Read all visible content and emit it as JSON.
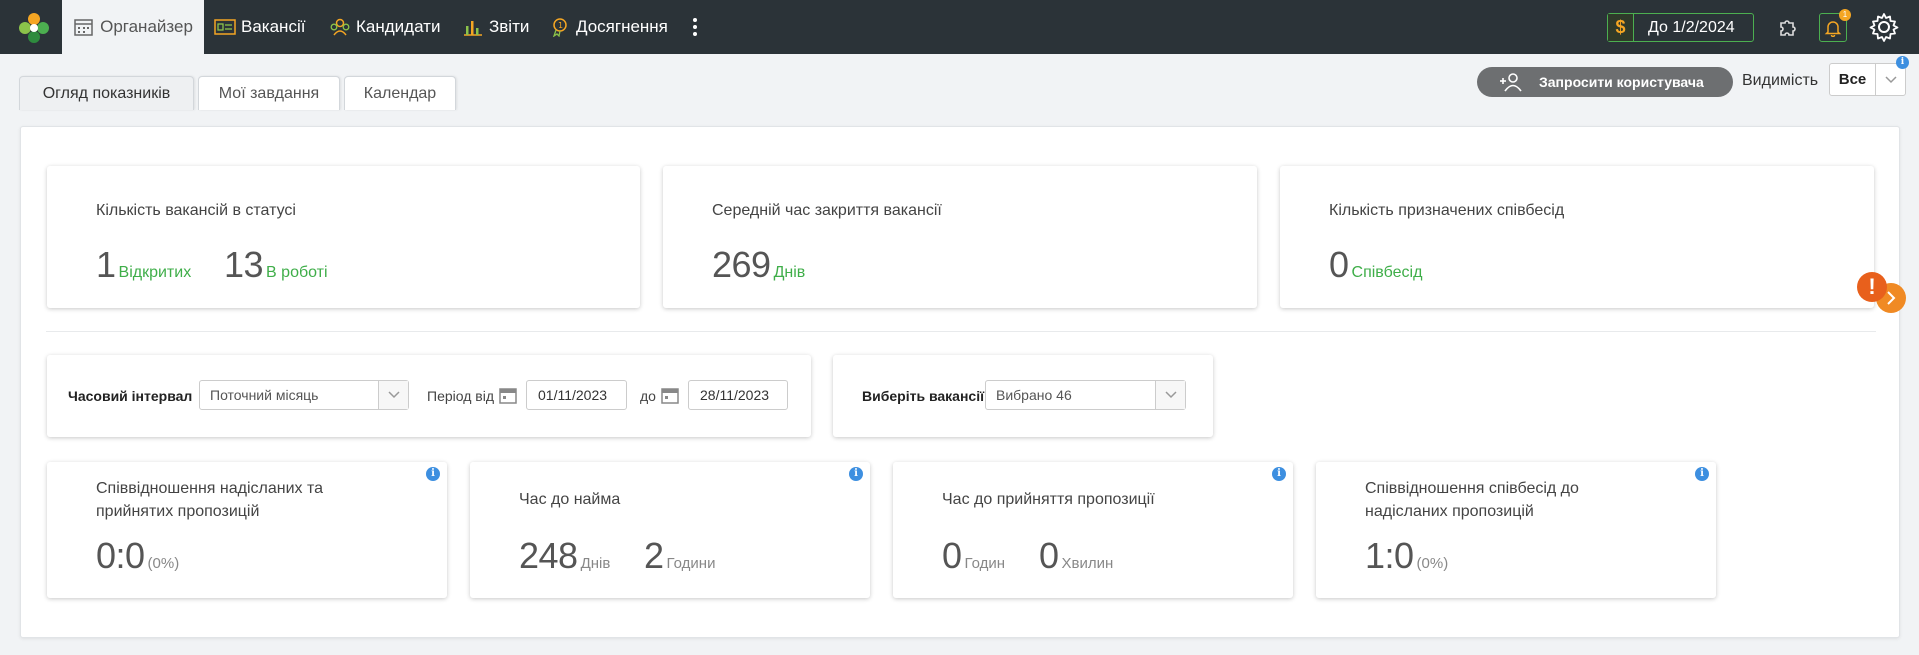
{
  "nav": {
    "items": [
      {
        "label": "Органайзер",
        "icon": "calendar-icon",
        "active": true
      },
      {
        "label": "Вакансії",
        "icon": "vacancy-icon"
      },
      {
        "label": "Кандидати",
        "icon": "candidates-icon"
      },
      {
        "label": "Звіти",
        "icon": "reports-icon"
      },
      {
        "label": "Досягнення",
        "icon": "achievements-icon"
      }
    ],
    "subscription": {
      "currency": "$",
      "label": "До 1/2/2024"
    },
    "notification_count": "1"
  },
  "tabs": [
    "Огляд показників",
    "Мої завдання",
    "Календар"
  ],
  "toolbar": {
    "invite_label": "Запросити користувача",
    "visibility_label": "Видимість",
    "visibility_value": "Все"
  },
  "summary_cards": [
    {
      "title": "Кількість вакансій в статусі",
      "metrics": [
        {
          "value": "1",
          "unit": "Відкритих"
        },
        {
          "value": "13",
          "unit": "В роботі"
        }
      ]
    },
    {
      "title": "Середній час закриття вакансії",
      "metrics": [
        {
          "value": "269",
          "unit": "Днів"
        }
      ]
    },
    {
      "title": "Кількість призначених співбесід",
      "metrics": [
        {
          "value": "0",
          "unit": "Співбесід"
        }
      ]
    }
  ],
  "filters": {
    "interval_label": "Часовий інтервал",
    "interval_value": "Поточний місяць",
    "period_from_label": "Період від",
    "date_from": "01/11/2023",
    "period_to_label": "до",
    "date_to": "28/11/2023",
    "vacancies_label": "Виберіть вакансії",
    "vacancies_value": "Вибрано 46"
  },
  "kpi_cards": [
    {
      "title_1": "Співвідношення надісланих та",
      "title_2": "прийнятих пропозицій",
      "value": "0:0",
      "note": "(0%)"
    },
    {
      "title": "Час до найма",
      "metrics": [
        {
          "value": "248",
          "unit": "Днів"
        },
        {
          "value": "2",
          "unit": "Години"
        }
      ]
    },
    {
      "title": "Час до прийняття пропозиції",
      "metrics": [
        {
          "value": "0",
          "unit": "Годин"
        },
        {
          "value": "0",
          "unit": "Хвилин"
        }
      ]
    },
    {
      "title_1": "Співвідношення співбесід до",
      "title_2": "надісланих пропозицій",
      "value": "1:0",
      "note": "(0%)"
    }
  ],
  "colors": {
    "topbar": "#2b3338",
    "accent_green": "#3fae49",
    "info_blue": "#3d8fe0",
    "alert_orange": "#e8601c"
  }
}
